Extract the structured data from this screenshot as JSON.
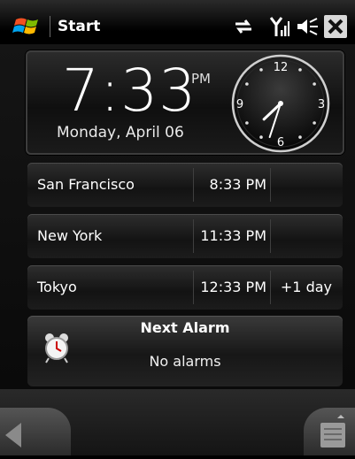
{
  "statusbar": {
    "title": "Start",
    "icons": [
      "windows-start-icon",
      "data-connection-icon",
      "signal-strength-icon",
      "speaker-muted-icon",
      "close-icon"
    ]
  },
  "clock": {
    "time": "7:33",
    "ampm": "PM",
    "date": "Monday, April 06",
    "analog": {
      "hour": 7,
      "minute": 33,
      "labels": [
        "12",
        "3",
        "6",
        "9"
      ]
    }
  },
  "world_clocks": [
    {
      "city": "San Francisco",
      "time": "8:33 PM",
      "day": ""
    },
    {
      "city": "New York",
      "time": "11:33 PM",
      "day": ""
    },
    {
      "city": "Tokyo",
      "time": "12:33 PM",
      "day": "+1 day"
    }
  ],
  "alarm": {
    "title": "Next Alarm",
    "status": "No alarms"
  },
  "softkeys": {
    "left_icon": "back-arrow-icon",
    "right_icon": "menu-icon"
  },
  "colors": {
    "background": "#000000",
    "panel": "#1c1c1c",
    "text": "#ffffff"
  }
}
